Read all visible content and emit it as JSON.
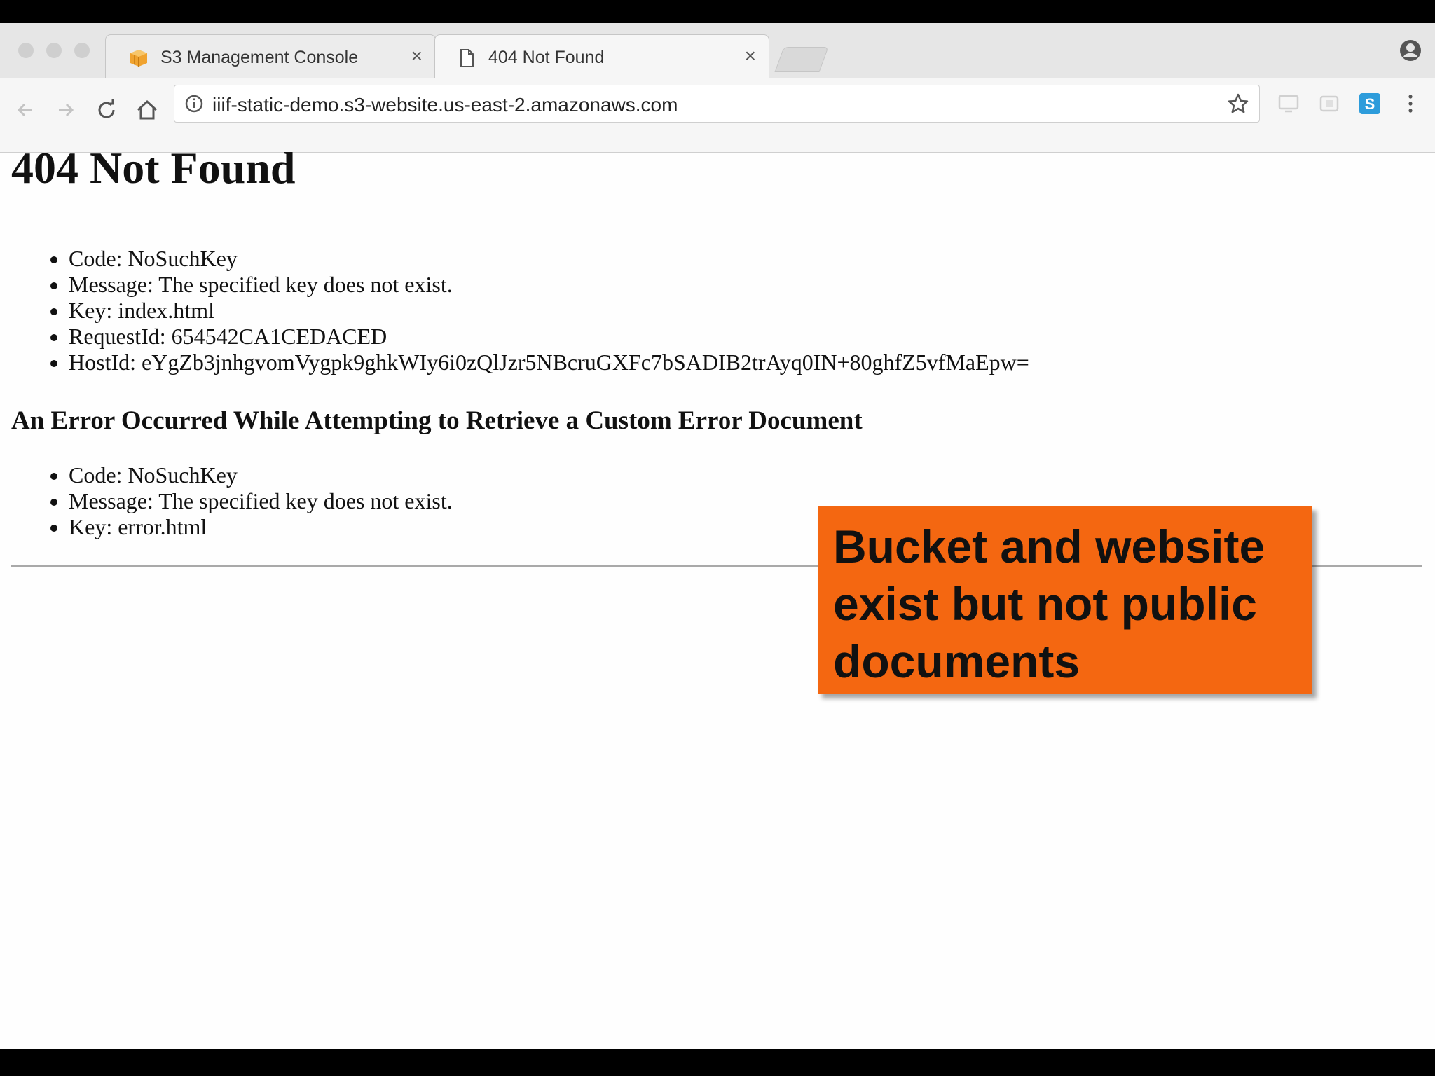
{
  "browser": {
    "tabs": [
      {
        "title": "S3 Management Console",
        "close": "×",
        "active": false,
        "favicon": "aws-box-icon"
      },
      {
        "title": "404 Not Found",
        "close": "×",
        "active": true,
        "favicon": "document-icon"
      }
    ],
    "url": "iiif-static-demo.s3-website.us-east-2.amazonaws.com"
  },
  "page": {
    "title": "404 Not Found",
    "details": [
      "Code: NoSuchKey",
      "Message: The specified key does not exist.",
      "Key: index.html",
      "RequestId: 654542CA1CEDACED",
      "HostId: eYgZb3jnhgvomVygpk9ghkWIy6i0zQlJzr5NBcruGXFc7bSADIB2trAyq0IN+80ghfZ5vfMaEpw="
    ],
    "subheading": "An Error Occurred While Attempting to Retrieve a Custom Error Document",
    "error_details": [
      "Code: NoSuchKey",
      "Message: The specified key does not exist.",
      "Key: error.html"
    ]
  },
  "callout": {
    "text": "Bucket and website exist but not public documents"
  },
  "colors": {
    "callout_bg": "#f46711",
    "tab_bg": "#e6e6e6",
    "extension_accent": "#2d9cdb"
  }
}
